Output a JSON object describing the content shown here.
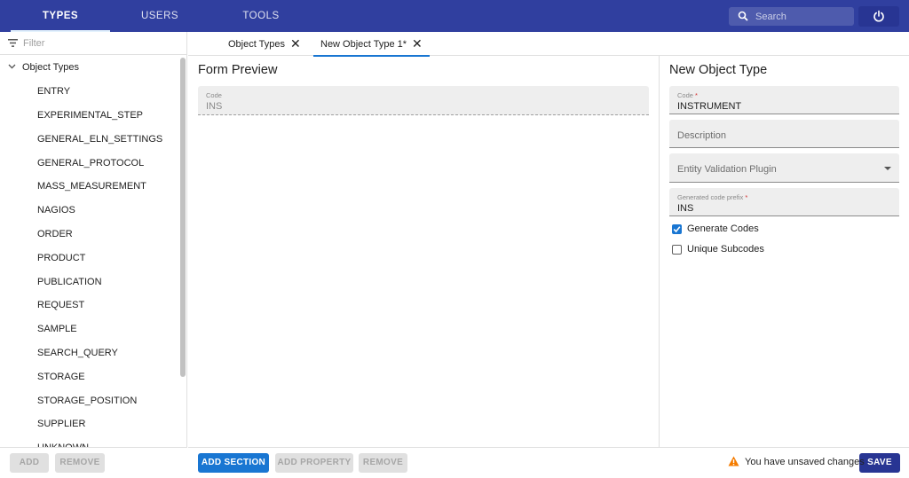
{
  "topbar": {
    "tabs": [
      {
        "label": "TYPES"
      },
      {
        "label": "USERS"
      },
      {
        "label": "TOOLS"
      }
    ],
    "search_placeholder": "Search",
    "color": "#303f9f"
  },
  "sidebar": {
    "filter_placeholder": "Filter",
    "root_label": "Object Types",
    "items": [
      {
        "label": "ENTRY"
      },
      {
        "label": "EXPERIMENTAL_STEP"
      },
      {
        "label": "GENERAL_ELN_SETTINGS"
      },
      {
        "label": "GENERAL_PROTOCOL"
      },
      {
        "label": "MASS_MEASUREMENT"
      },
      {
        "label": "NAGIOS"
      },
      {
        "label": "ORDER"
      },
      {
        "label": "PRODUCT"
      },
      {
        "label": "PUBLICATION"
      },
      {
        "label": "REQUEST"
      },
      {
        "label": "SAMPLE"
      },
      {
        "label": "SEARCH_QUERY"
      },
      {
        "label": "STORAGE"
      },
      {
        "label": "STORAGE_POSITION"
      },
      {
        "label": "SUPPLIER"
      },
      {
        "label": "UNKNOWN"
      }
    ],
    "add_label": "ADD",
    "remove_label": "REMOVE"
  },
  "subtabs": [
    {
      "label": "Object Types"
    },
    {
      "label": "New Object Type 1*"
    }
  ],
  "preview": {
    "title": "Form Preview",
    "code_label": "Code",
    "code_value": "INS"
  },
  "details": {
    "title": "New Object Type",
    "code_label": "Code",
    "code_value": "INSTRUMENT",
    "description_placeholder": "Description",
    "plugin_placeholder": "Entity Validation Plugin",
    "prefix_label": "Generated code prefix",
    "prefix_value": "INS",
    "required_mark": "*",
    "generate_codes_label": "Generate Codes",
    "generate_codes_checked": true,
    "unique_subcodes_label": "Unique Subcodes",
    "unique_subcodes_checked": false
  },
  "footer": {
    "add_section": "ADD SECTION",
    "add_property": "ADD PROPERTY",
    "remove": "REMOVE",
    "unsaved_message": "You have unsaved changes",
    "save": "SAVE",
    "warning_color": "#f57c00"
  }
}
